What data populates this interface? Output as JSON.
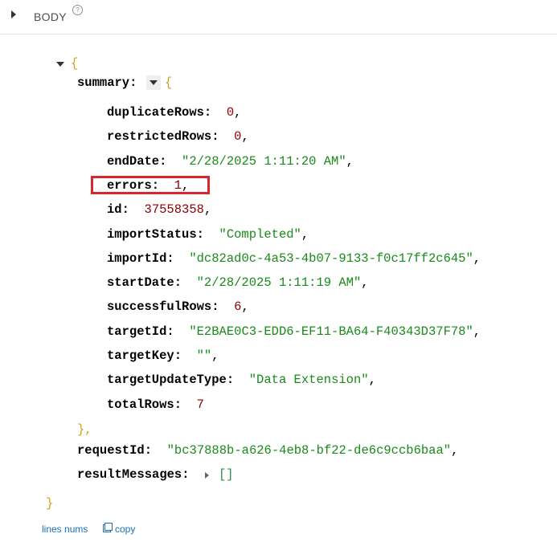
{
  "section": {
    "label": "BODY",
    "help": "?"
  },
  "json": {
    "open_brace": "{",
    "close_brace": "}",
    "summary": {
      "key": "summary:",
      "open_brace": "{",
      "close_brace": "},",
      "fields": [
        {
          "key": "duplicateRows:",
          "value": "0",
          "type": "num",
          "comma": ","
        },
        {
          "key": "restrictedRows:",
          "value": "0",
          "type": "num",
          "comma": ","
        },
        {
          "key": "endDate:",
          "value": "\"2/28/2025 1:11:20 AM\"",
          "type": "str",
          "comma": ","
        },
        {
          "key": "errors:",
          "value": "1",
          "type": "num",
          "comma": ","
        },
        {
          "key": "id:",
          "value": "37558358",
          "type": "num",
          "comma": ","
        },
        {
          "key": "importStatus:",
          "value": "\"Completed\"",
          "type": "str",
          "comma": ","
        },
        {
          "key": "importId:",
          "value": "\"dc82ad0c-4a53-4b07-9133-f0c17ff2c645\"",
          "type": "str",
          "comma": ","
        },
        {
          "key": "startDate:",
          "value": "\"2/28/2025 1:11:19 AM\"",
          "type": "str",
          "comma": ","
        },
        {
          "key": "successfulRows:",
          "value": "6",
          "type": "num",
          "comma": ","
        },
        {
          "key": "targetId:",
          "value": "\"E2BAE0C3-EDD6-EF11-BA64-F40343D37F78\"",
          "type": "str",
          "comma": ","
        },
        {
          "key": "targetKey:",
          "value": "\"\"",
          "type": "str",
          "comma": ","
        },
        {
          "key": "targetUpdateType:",
          "value": "\"Data Extension\"",
          "type": "str",
          "comma": ","
        },
        {
          "key": "totalRows:",
          "value": "7",
          "type": "num",
          "comma": ""
        }
      ]
    },
    "requestId": {
      "key": "requestId:",
      "value": "\"bc37888b-a626-4eb8-bf22-de6c9ccb6baa\"",
      "comma": ","
    },
    "resultMessages": {
      "key": "resultMessages:",
      "value": "[]"
    }
  },
  "footer": {
    "lines_nums": "lines nums",
    "copy": "copy"
  },
  "colors": {
    "highlight": "#d9252b",
    "string": "#1a8a1a",
    "number": "#8b0000",
    "brace": "#d1a317",
    "link": "#1a6fb8"
  }
}
